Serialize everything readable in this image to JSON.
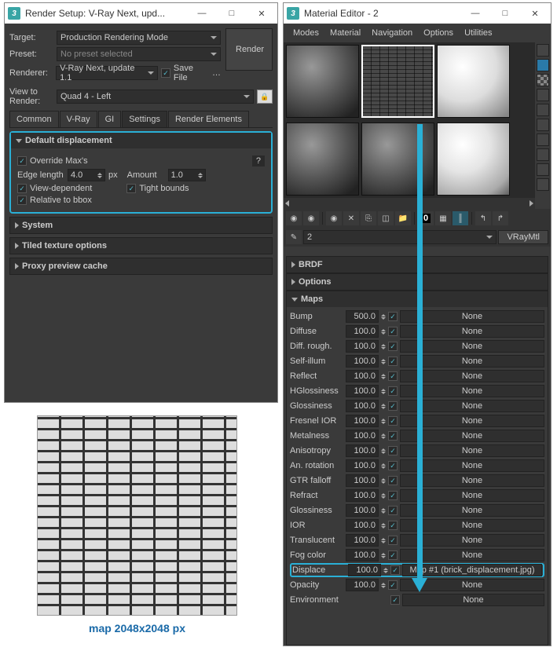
{
  "renderSetup": {
    "title": "Render Setup: V-Ray Next, upd...",
    "targetLabel": "Target:",
    "target": "Production Rendering Mode",
    "presetLabel": "Preset:",
    "preset": "No preset selected",
    "rendererLabel": "Renderer:",
    "renderer": "V-Ray Next, update 1.1",
    "saveFile": "Save File",
    "renderBtn": "Render",
    "viewLabel": "View to Render:",
    "view": "Quad 4 - Left",
    "tabs": [
      "Common",
      "V-Ray",
      "GI",
      "Settings",
      "Render Elements"
    ],
    "activeTab": 3,
    "displacement": {
      "title": "Default displacement",
      "override": "Override Max's",
      "edgeLabel": "Edge length",
      "edgeVal": "4.0",
      "px": "px",
      "amountLabel": "Amount",
      "amountVal": "1.0",
      "viewDep": "View-dependent",
      "tight": "Tight bounds",
      "relative": "Relative to bbox",
      "help": "?"
    },
    "panels": [
      "System",
      "Tiled texture options",
      "Proxy preview cache"
    ]
  },
  "matEditor": {
    "title": "Material Editor - 2",
    "menus": [
      "Modes",
      "Material",
      "Navigation",
      "Options",
      "Utilities"
    ],
    "slotName": "2",
    "matType": "VRayMtl",
    "sections": [
      "BRDF",
      "Options",
      "Maps"
    ],
    "maps": [
      {
        "name": "Bump",
        "val": "500.0",
        "slot": "None"
      },
      {
        "name": "Diffuse",
        "val": "100.0",
        "slot": "None"
      },
      {
        "name": "Diff. rough.",
        "val": "100.0",
        "slot": "None"
      },
      {
        "name": "Self-illum",
        "val": "100.0",
        "slot": "None"
      },
      {
        "name": "Reflect",
        "val": "100.0",
        "slot": "None"
      },
      {
        "name": "HGlossiness",
        "val": "100.0",
        "slot": "None"
      },
      {
        "name": "Glossiness",
        "val": "100.0",
        "slot": "None"
      },
      {
        "name": "Fresnel IOR",
        "val": "100.0",
        "slot": "None"
      },
      {
        "name": "Metalness",
        "val": "100.0",
        "slot": "None"
      },
      {
        "name": "Anisotropy",
        "val": "100.0",
        "slot": "None"
      },
      {
        "name": "An. rotation",
        "val": "100.0",
        "slot": "None"
      },
      {
        "name": "GTR falloff",
        "val": "100.0",
        "slot": "None"
      },
      {
        "name": "Refract",
        "val": "100.0",
        "slot": "None"
      },
      {
        "name": "Glossiness",
        "val": "100.0",
        "slot": "None"
      },
      {
        "name": "IOR",
        "val": "100.0",
        "slot": "None"
      },
      {
        "name": "Translucent",
        "val": "100.0",
        "slot": "None"
      },
      {
        "name": "Fog color",
        "val": "100.0",
        "slot": "None"
      },
      {
        "name": "Displace",
        "val": "100.0",
        "slot": "Map #1 (brick_displacement.jpg)",
        "hl": true
      },
      {
        "name": "Opacity",
        "val": "100.0",
        "slot": "None"
      },
      {
        "name": "Environment",
        "val": "",
        "slot": "None",
        "noVal": true
      }
    ]
  },
  "brickCaption": "map 2048x2048 px"
}
